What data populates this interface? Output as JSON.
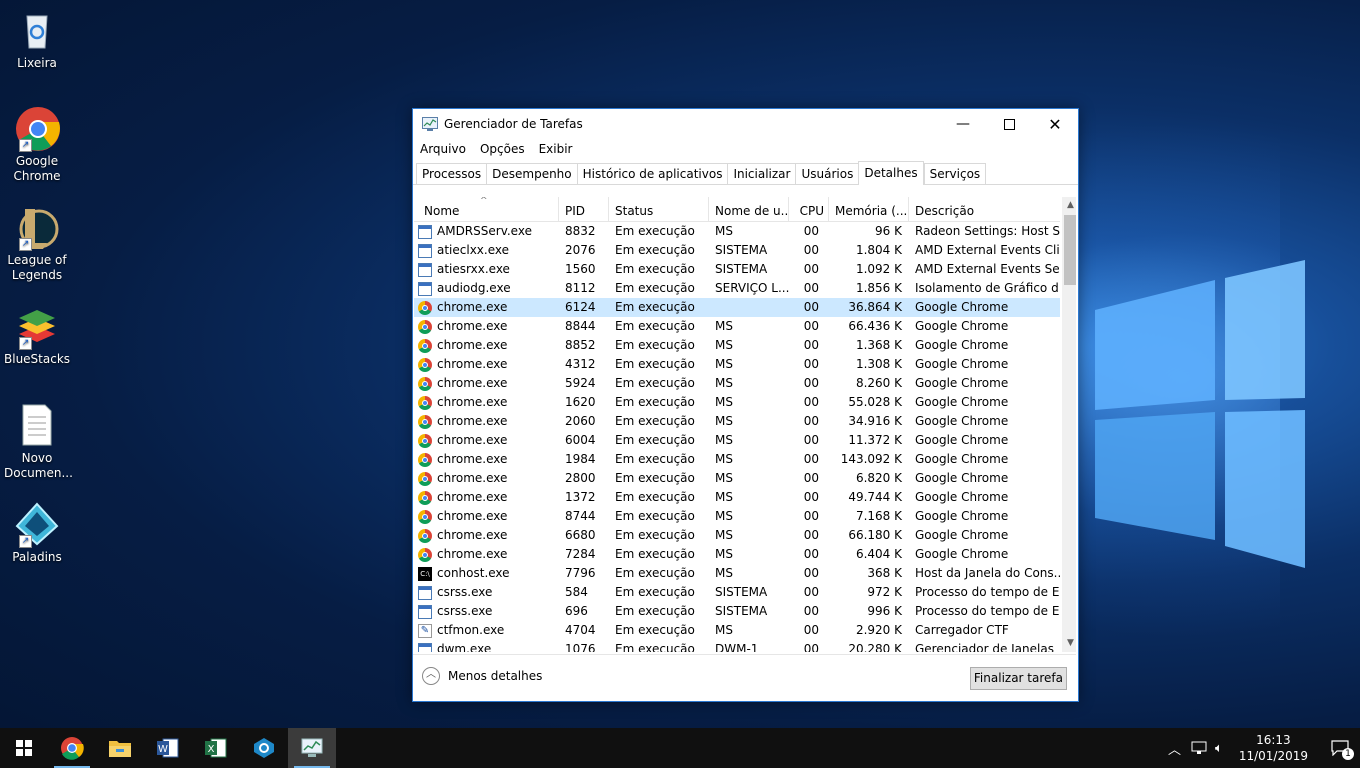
{
  "desktop": {
    "icons": [
      {
        "label": "Lixeira"
      },
      {
        "label": "Google Chrome"
      },
      {
        "label": "League of Legends"
      },
      {
        "label": "BlueStacks"
      },
      {
        "label": "Novo Documen..."
      },
      {
        "label": "Paladins"
      }
    ]
  },
  "window": {
    "title": "Gerenciador de Tarefas",
    "menu": [
      "Arquivo",
      "Opções",
      "Exibir"
    ],
    "tabs": [
      "Processos",
      "Desempenho",
      "Histórico de aplicativos",
      "Inicializar",
      "Usuários",
      "Detalhes",
      "Serviços"
    ],
    "active_tab": "Detalhes",
    "columns": [
      "Nome",
      "PID",
      "Status",
      "Nome de u...",
      "CPU",
      "Memória (...",
      "Descrição"
    ],
    "rows": [
      [
        "AMDRSServ.exe",
        "8832",
        "Em execução",
        "MS",
        "00",
        "96 K",
        "Radeon Settings: Host S...",
        "exe"
      ],
      [
        "atieclxx.exe",
        "2076",
        "Em execução",
        "SISTEMA",
        "00",
        "1.804 K",
        "AMD External Events Cli...",
        "exe"
      ],
      [
        "atiesrxx.exe",
        "1560",
        "Em execução",
        "SISTEMA",
        "00",
        "1.092 K",
        "AMD External Events Ser...",
        "exe"
      ],
      [
        "audiodg.exe",
        "8112",
        "Em execução",
        "SERVIÇO L...",
        "00",
        "1.856 K",
        "Isolamento de Gráfico d...",
        "exe"
      ],
      [
        "chrome.exe",
        "6124",
        "Em execução",
        "",
        "00",
        "36.864 K",
        "Google Chrome",
        "chrome"
      ],
      [
        "chrome.exe",
        "8844",
        "Em execução",
        "MS",
        "00",
        "66.436 K",
        "Google Chrome",
        "chrome"
      ],
      [
        "chrome.exe",
        "8852",
        "Em execução",
        "MS",
        "00",
        "1.368 K",
        "Google Chrome",
        "chrome"
      ],
      [
        "chrome.exe",
        "4312",
        "Em execução",
        "MS",
        "00",
        "1.308 K",
        "Google Chrome",
        "chrome"
      ],
      [
        "chrome.exe",
        "5924",
        "Em execução",
        "MS",
        "00",
        "8.260 K",
        "Google Chrome",
        "chrome"
      ],
      [
        "chrome.exe",
        "1620",
        "Em execução",
        "MS",
        "00",
        "55.028 K",
        "Google Chrome",
        "chrome"
      ],
      [
        "chrome.exe",
        "2060",
        "Em execução",
        "MS",
        "00",
        "34.916 K",
        "Google Chrome",
        "chrome"
      ],
      [
        "chrome.exe",
        "6004",
        "Em execução",
        "MS",
        "00",
        "11.372 K",
        "Google Chrome",
        "chrome"
      ],
      [
        "chrome.exe",
        "1984",
        "Em execução",
        "MS",
        "00",
        "143.092 K",
        "Google Chrome",
        "chrome"
      ],
      [
        "chrome.exe",
        "2800",
        "Em execução",
        "MS",
        "00",
        "6.820 K",
        "Google Chrome",
        "chrome"
      ],
      [
        "chrome.exe",
        "1372",
        "Em execução",
        "MS",
        "00",
        "49.744 K",
        "Google Chrome",
        "chrome"
      ],
      [
        "chrome.exe",
        "8744",
        "Em execução",
        "MS",
        "00",
        "7.168 K",
        "Google Chrome",
        "chrome"
      ],
      [
        "chrome.exe",
        "6680",
        "Em execução",
        "MS",
        "00",
        "66.180 K",
        "Google Chrome",
        "chrome"
      ],
      [
        "chrome.exe",
        "7284",
        "Em execução",
        "MS",
        "00",
        "6.404 K",
        "Google Chrome",
        "chrome"
      ],
      [
        "conhost.exe",
        "7796",
        "Em execução",
        "MS",
        "00",
        "368 K",
        "Host da Janela do Cons...",
        "console"
      ],
      [
        "csrss.exe",
        "584",
        "Em execução",
        "SISTEMA",
        "00",
        "972 K",
        "Processo do tempo de E...",
        "exe"
      ],
      [
        "csrss.exe",
        "696",
        "Em execução",
        "SISTEMA",
        "00",
        "996 K",
        "Processo do tempo de E...",
        "exe"
      ],
      [
        "ctfmon.exe",
        "4704",
        "Em execução",
        "MS",
        "00",
        "2.920 K",
        "Carregador CTF",
        "pen"
      ],
      [
        "dwm.exe",
        "1076",
        "Em execução",
        "DWM-1",
        "00",
        "20.280 K",
        "Gerenciador de Janelas",
        "exe"
      ]
    ],
    "selected_row": 4,
    "less_details": "Menos detalhes",
    "end_task": "Finalizar tarefa"
  },
  "taskbar": {
    "apps": [
      "start-icon",
      "chrome-icon",
      "file-explorer-icon",
      "word-icon",
      "excel-icon",
      "app-icon",
      "task-manager-icon"
    ],
    "time": "16:13",
    "date": "11/01/2019",
    "notifications": "1"
  }
}
